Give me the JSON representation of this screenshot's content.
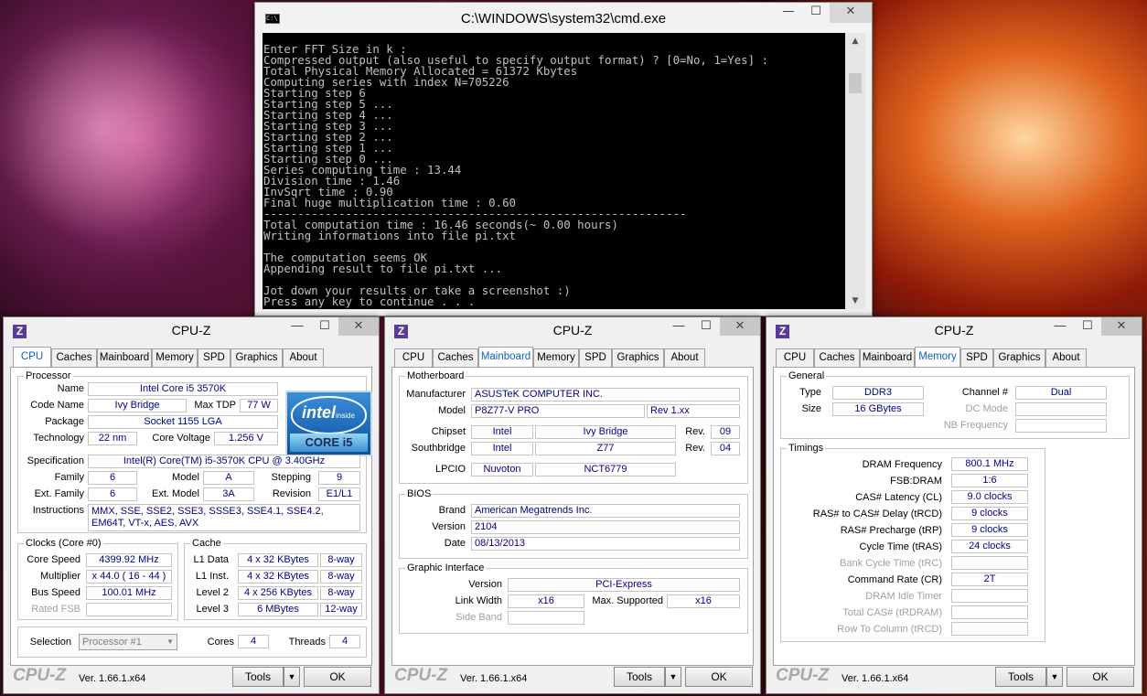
{
  "cmd": {
    "title": "C:\\WINDOWS\\system32\\cmd.exe",
    "icon": "C:\\",
    "lines": [
      "Enter FFT Size in k :",
      "Compressed output (also useful to specify output format) ? [0=No, 1=Yes] :",
      "Total Physical Memory Allocated = 61372 Kbytes",
      "Computing series with index N=705226",
      "Starting step 6",
      "Starting step 5 ...",
      "Starting step 4 ...",
      "Starting step 3 ...",
      "Starting step 2 ...",
      "Starting step 1 ...",
      "Starting step 0 ...",
      "Series computing time : 13.44",
      "Division time : 1.46",
      "InvSqrt time : 0.90",
      "Final huge multiplication time : 0.60",
      "--------------------------------------------------------------",
      "Total computation time : 16.46 seconds(~ 0.00 hours)",
      "Writing informations into file pi.txt",
      "",
      "The computation seems OK",
      "Appending result to file pi.txt ...",
      "",
      "Jot down your results or take a screenshot :)",
      "Press any key to continue . . ."
    ]
  },
  "common": {
    "title": "CPU-Z",
    "brand": "CPU-Z",
    "version": "Ver. 1.66.1.x64",
    "tools": "Tools",
    "ok": "OK",
    "tabs": [
      "CPU",
      "Caches",
      "Mainboard",
      "Memory",
      "SPD",
      "Graphics",
      "About"
    ],
    "min": "—",
    "max": "☐",
    "close": "✕",
    "arrow": "▼"
  },
  "cpu": {
    "processor_title": "Processor",
    "name_label": "Name",
    "name": "Intel Core i5 3570K",
    "codename_label": "Code Name",
    "codename": "Ivy Bridge",
    "maxtdp_label": "Max TDP",
    "maxtdp": "77 W",
    "package_label": "Package",
    "package": "Socket 1155 LGA",
    "tech_label": "Technology",
    "tech": "22 nm",
    "voltage_label": "Core Voltage",
    "voltage": "1.256 V",
    "spec_label": "Specification",
    "spec": "Intel(R) Core(TM) i5-3570K CPU @ 3.40GHz",
    "family_label": "Family",
    "family": "6",
    "model_label": "Model",
    "model": "A",
    "stepping_label": "Stepping",
    "stepping": "9",
    "extfamily_label": "Ext. Family",
    "extfamily": "6",
    "extmodel_label": "Ext. Model",
    "extmodel": "3A",
    "revision_label": "Revision",
    "revision": "E1/L1",
    "instr_label": "Instructions",
    "instr": "MMX, SSE, SSE2, SSE3, SSSE3, SSE4.1, SSE4.2, EM64T, VT-x, AES, AVX",
    "intel_logo": "intel",
    "intel_inside": "inside",
    "intel_core": "CORE i5",
    "clocks_title": "Clocks (Core #0)",
    "corespeed_label": "Core Speed",
    "corespeed": "4399.92 MHz",
    "mult_label": "Multiplier",
    "mult": "x 44.0 ( 16 - 44 )",
    "bus_label": "Bus Speed",
    "bus": "100.01 MHz",
    "fsb_label": "Rated FSB",
    "cache_title": "Cache",
    "l1d_label": "L1 Data",
    "l1d": "4 x 32 KBytes",
    "l1d_way": "8-way",
    "l1i_label": "L1 Inst.",
    "l1i": "4 x 32 KBytes",
    "l1i_way": "8-way",
    "l2_label": "Level 2",
    "l2": "4 x 256 KBytes",
    "l2_way": "8-way",
    "l3_label": "Level 3",
    "l3": "6 MBytes",
    "l3_way": "12-way",
    "selection_label": "Selection",
    "selection": "Processor #1",
    "cores_label": "Cores",
    "cores": "4",
    "threads_label": "Threads",
    "threads": "4"
  },
  "mb": {
    "mb_title": "Motherboard",
    "manu_label": "Manufacturer",
    "manu": "ASUSTeK COMPUTER INC.",
    "model_label": "Model",
    "model": "P8Z77-V PRO",
    "rev": "Rev 1.xx",
    "chipset_label": "Chipset",
    "chipset_v": "Intel",
    "chipset_n": "Ivy Bridge",
    "chipset_rev_label": "Rev.",
    "chipset_rev": "09",
    "sb_label": "Southbridge",
    "sb_v": "Intel",
    "sb_n": "Z77",
    "sb_rev_label": "Rev.",
    "sb_rev": "04",
    "lpcio_label": "LPCIO",
    "lpcio_v": "Nuvoton",
    "lpcio_n": "NCT6779",
    "bios_title": "BIOS",
    "brand_label": "Brand",
    "brand": "American Megatrends Inc.",
    "version_label": "Version",
    "version": "2104",
    "date_label": "Date",
    "date": "08/13/2013",
    "gi_title": "Graphic Interface",
    "giver_label": "Version",
    "giver": "PCI-Express",
    "lw_label": "Link Width",
    "lw": "x16",
    "maxsup_label": "Max. Supported",
    "maxsup": "x16",
    "sideband_label": "Side Band"
  },
  "mem": {
    "general_title": "General",
    "type_label": "Type",
    "type": "DDR3",
    "channel_label": "Channel #",
    "channel": "Dual",
    "size_label": "Size",
    "size": "16 GBytes",
    "dc_label": "DC Mode",
    "nb_label": "NB Frequency",
    "timings_title": "Timings",
    "dram_label": "DRAM Frequency",
    "dram": "800.1 MHz",
    "fsb_label": "FSB:DRAM",
    "fsb": "1:6",
    "cl_label": "CAS# Latency (CL)",
    "cl": "9.0 clocks",
    "trcd_label": "RAS# to CAS# Delay (tRCD)",
    "trcd": "9 clocks",
    "trp_label": "RAS# Precharge (tRP)",
    "trp": "9 clocks",
    "tras_label": "Cycle Time (tRAS)",
    "tras": "24 clocks",
    "trc_label": "Bank Cycle Time (tRC)",
    "cr_label": "Command Rate (CR)",
    "cr": "2T",
    "idle_label": "DRAM Idle Timer",
    "trdram_label": "Total CAS# (tRDRAM)",
    "trcdr_label": "Row To Column (tRCD)"
  }
}
